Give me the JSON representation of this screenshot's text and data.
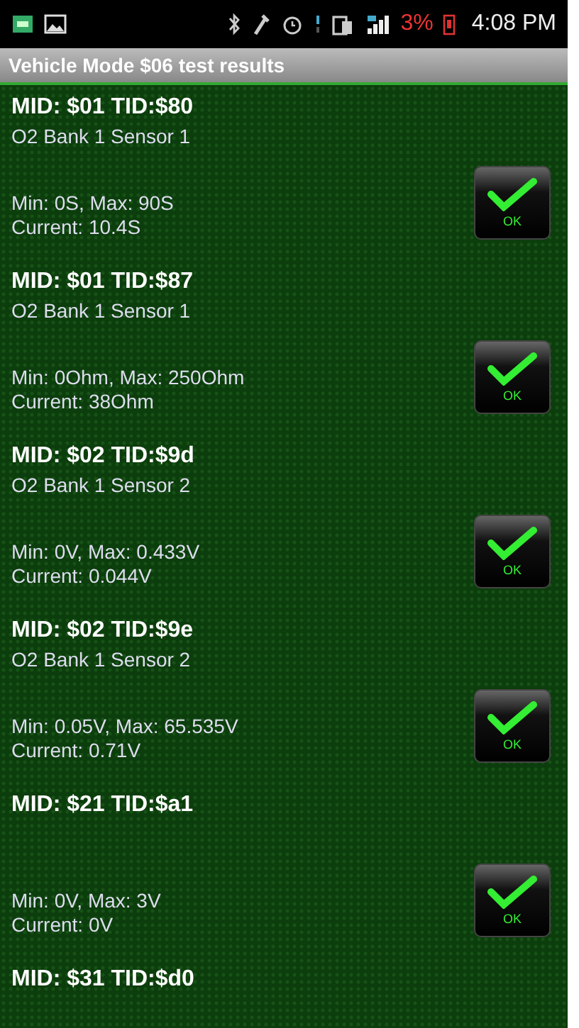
{
  "status_bar": {
    "battery": "3%",
    "time": "4:08 PM"
  },
  "app_bar": {
    "title": "Vehicle Mode $06 test results"
  },
  "results": [
    {
      "title": "MID: $01 TID:$80",
      "sensor": "O2 Bank 1 Sensor 1",
      "range": "Min: 0S, Max: 90S",
      "current": "Current: 10.4S",
      "passed": true,
      "badge": "OK"
    },
    {
      "title": "MID: $01 TID:$87",
      "sensor": "O2 Bank 1 Sensor 1",
      "range": "Min: 0Ohm, Max: 250Ohm",
      "current": "Current: 38Ohm",
      "passed": true,
      "badge": "OK"
    },
    {
      "title": "MID: $02 TID:$9d",
      "sensor": "O2 Bank 1 Sensor 2",
      "range": "Min: 0V, Max: 0.433V",
      "current": "Current: 0.044V",
      "passed": true,
      "badge": "OK"
    },
    {
      "title": "MID: $02 TID:$9e",
      "sensor": "O2 Bank 1 Sensor 2",
      "range": "Min: 0.05V, Max: 65.535V",
      "current": "Current: 0.71V",
      "passed": true,
      "badge": "OK"
    },
    {
      "title": "MID: $21 TID:$a1",
      "range": "Min: 0V, Max: 3V",
      "current": "Current: 0V",
      "passed": true,
      "badge": "OK"
    },
    {
      "title": "MID: $31 TID:$d0"
    }
  ]
}
